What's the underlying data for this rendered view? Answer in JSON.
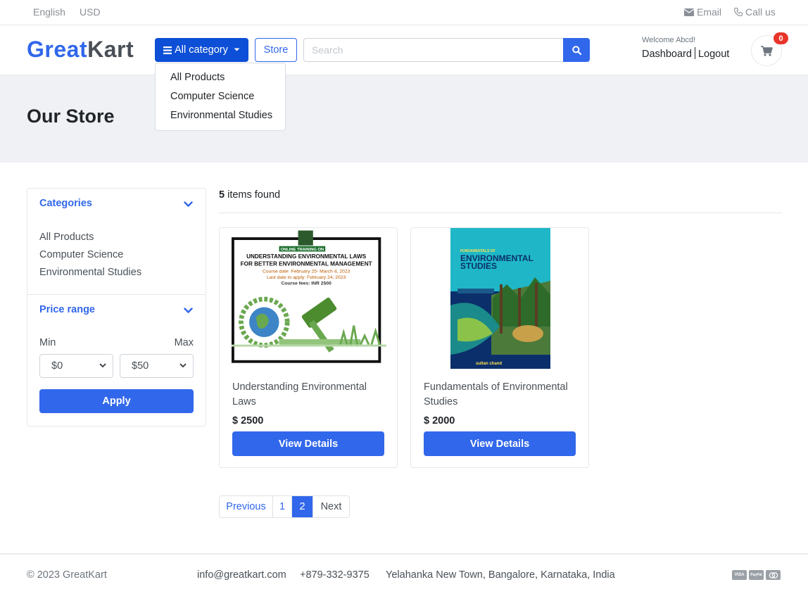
{
  "topbar": {
    "language": "English",
    "currency": "USD",
    "email_label": "Email",
    "call_label": "Call us"
  },
  "header": {
    "logo_part1": "Great",
    "logo_part2": "Kart",
    "category_button": "All category",
    "store_button": "Store",
    "search_placeholder": "Search",
    "welcome": "Welcome Abcd!",
    "dashboard_link": "Dashboard",
    "logout_link": "Logout",
    "cart_count": "0"
  },
  "category_dropdown": {
    "items": [
      "All Products",
      "Computer Science",
      "Environmental Studies"
    ]
  },
  "banner": {
    "title": "Our Store"
  },
  "sidebar": {
    "categories_title": "Categories",
    "categories": [
      "All Products",
      "Computer Science",
      "Environmental Studies"
    ],
    "price_title": "Price range",
    "min_label": "Min",
    "max_label": "Max",
    "min_value": "$0",
    "max_value": "$50",
    "apply_label": "Apply"
  },
  "results": {
    "count": "5",
    "count_suffix": "items found"
  },
  "products": [
    {
      "title": "Understanding Environmental Laws",
      "price": "$ 2500",
      "button": "View Details",
      "image": {
        "badge": "ONLINE TRAINING ON",
        "line1": "UNDERSTANDING ENVIRONMENTAL LAWS",
        "line2": "FOR BETTER ENVIRONMENTAL MANAGEMENT",
        "line3": "Course date: February 25- March 4, 2023",
        "line4": "Last date to apply: February 24, 2023",
        "line5": "Course fees: INR 2500"
      }
    },
    {
      "title": "Fundamentals of Environmental Studies",
      "price": "$ 2000",
      "button": "View Details",
      "image": {
        "small": "FUNDAMENTALS OF",
        "big1": "ENVIRONMENTAL",
        "big2": "STUDIES",
        "publisher": "sultan chand"
      }
    }
  ],
  "pagination": {
    "previous": "Previous",
    "page1": "1",
    "page2": "2",
    "next": "Next"
  },
  "footer": {
    "copyright": "© 2023 GreatKart",
    "email": "info@greatkart.com",
    "phone": "+879-332-9375",
    "address": "Yelahanka New Town, Bangalore, Karnataka, India",
    "payment_icons": [
      "VISA",
      "PayPal",
      "MC"
    ]
  },
  "colors": {
    "primary": "#3167eb",
    "category_button": "#0d4fd6",
    "badge": "#e8352b",
    "banner_bg": "#eff1f4"
  }
}
